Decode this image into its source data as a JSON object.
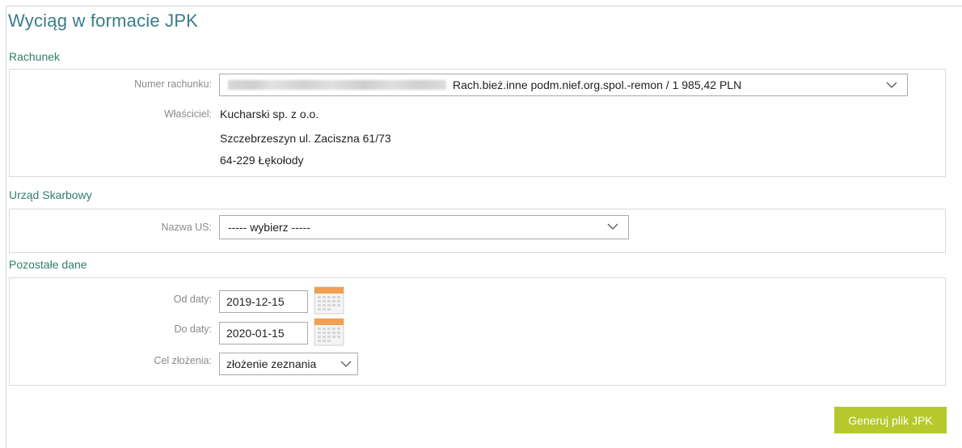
{
  "page": {
    "title": "Wyciąg w formacie JPK"
  },
  "rachunek": {
    "section_title": "Rachunek",
    "account_label": "Numer rachunku:",
    "account_value": "Rach.bież.inne podm.nief.org.spol.-remon / 1 985,42 PLN",
    "owner_label": "Właściciel:",
    "owner_lines": [
      "Kucharski sp. z o.o.",
      "Szczebrzeszyn ul. Zaciszna 61/73",
      "64-229 Łękołody"
    ]
  },
  "urzad": {
    "section_title": "Urząd Skarbowy",
    "us_label": "Nazwa US:",
    "us_value": "----- wybierz -----"
  },
  "pozostale": {
    "section_title": "Pozostałe dane",
    "from_label": "Od daty:",
    "from_value": "2019-12-15",
    "to_label": "Do daty:",
    "to_value": "2020-01-15",
    "purpose_label": "Cel złożenia:",
    "purpose_value": "złożenie zeznania"
  },
  "actions": {
    "generate_label": "Generuj plik JPK"
  },
  "colors": {
    "title": "#3a7d8a",
    "section_title": "#2e7d6b",
    "button": "#b5c92c",
    "calendar_header": "#f0a050"
  },
  "icons": {
    "dropdown": "chevron-down-icon",
    "calendar": "calendar-icon"
  }
}
